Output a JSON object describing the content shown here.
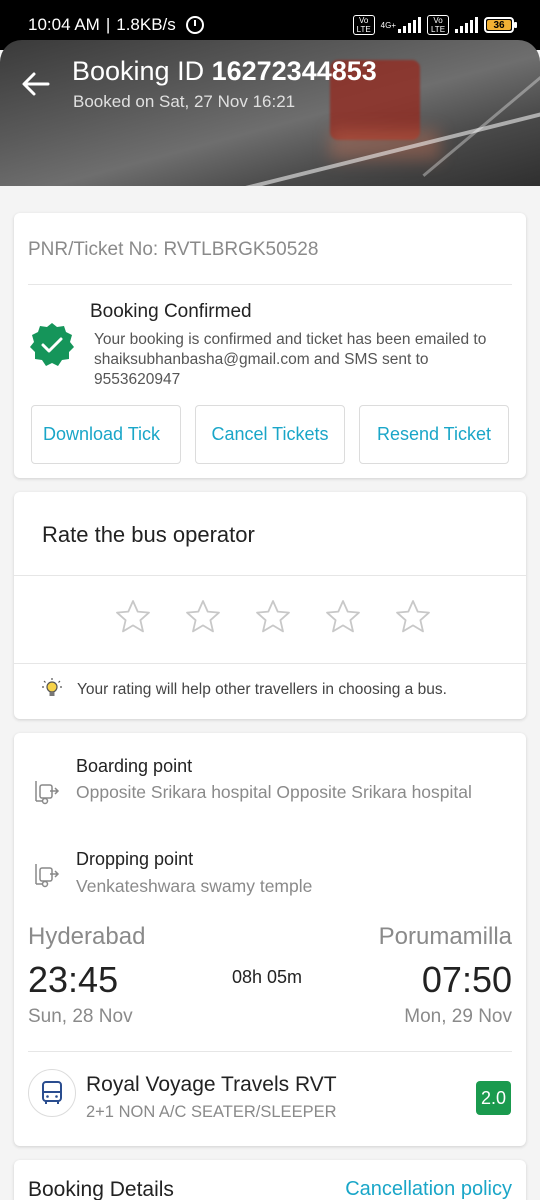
{
  "status_bar": {
    "time": "10:04 AM",
    "speed": "1.8KB/s",
    "network": "4G+",
    "volte": "Vo LTE",
    "battery": "36"
  },
  "header": {
    "title_prefix": "Booking ID",
    "booking_id": "16272344853",
    "booked_on": "Booked on Sat, 27 Nov 16:21"
  },
  "ticket": {
    "pnr": "PNR/Ticket No: RVTLBRGK50528",
    "status_title": "Booking Confirmed",
    "status_message": "Your booking is confirmed and ticket has been emailed to shaiksubhanbasha@gmail.com and SMS sent to 9553620947",
    "buttons": {
      "download": "Download Tick",
      "cancel": "Cancel Tickets",
      "resend": "Resend Ticket"
    }
  },
  "rating": {
    "title": "Rate the bus operator",
    "stars_total": 5,
    "stars_selected": 0,
    "tip": "Your rating will help other travellers in choosing a bus."
  },
  "journey": {
    "boarding_label": "Boarding point",
    "boarding_value": "Opposite Srikara hospital Opposite Srikara hospital",
    "dropping_label": "Dropping point",
    "dropping_value": "Venkateshwara swamy temple",
    "from_city": "Hyderabad",
    "to_city": "Porumamilla",
    "dep_time": "23:45",
    "arr_time": "07:50",
    "duration": "08h 05m",
    "dep_date": "Sun, 28 Nov",
    "arr_date": "Mon, 29 Nov",
    "operator_name": "Royal Voyage Travels RVT",
    "bus_type": "2+1 NON A/C SEATER/SLEEPER",
    "operator_rating": "2.0"
  },
  "booking_details": {
    "title": "Booking Details",
    "cancellation_link": "Cancellation policy"
  },
  "colors": {
    "accent": "#1aa6c8",
    "success": "#1a9a4e",
    "confirm_icon": "#15955a"
  }
}
